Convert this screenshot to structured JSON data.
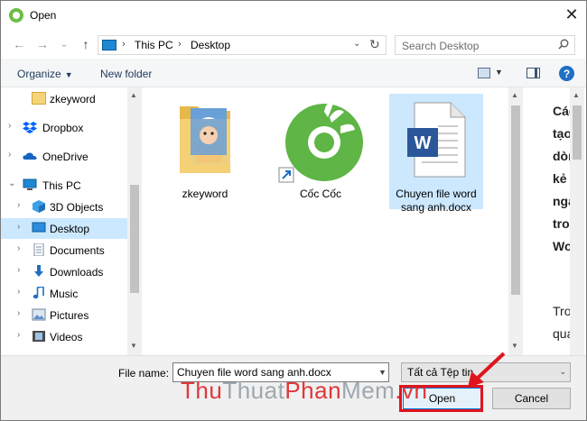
{
  "window": {
    "title": "Open",
    "close_label": "✕",
    "app_icon": "coccoc-icon"
  },
  "nav": {
    "back": "←",
    "forward": "→",
    "recent": "⌄",
    "up": "↑",
    "breadcrumb": [
      "This PC",
      "Desktop"
    ],
    "search_placeholder": "Search Desktop"
  },
  "toolbar": {
    "organize": "Organize",
    "new_folder": "New folder",
    "help": "?"
  },
  "sidebar": {
    "items": [
      {
        "label": "zkeyword",
        "icon": "folder-icon",
        "expandable": false,
        "selected": false
      },
      {
        "label": "Dropbox",
        "icon": "dropbox-icon",
        "expandable": true,
        "selected": false
      },
      {
        "label": "OneDrive",
        "icon": "onedrive-icon",
        "expandable": true,
        "selected": false
      },
      {
        "label": "This PC",
        "icon": "computer-icon",
        "expandable": true,
        "expanded": true,
        "selected": false
      },
      {
        "label": "3D Objects",
        "icon": "cube-icon",
        "expandable": true,
        "selected": false
      },
      {
        "label": "Desktop",
        "icon": "desktop-icon",
        "expandable": true,
        "selected": true
      },
      {
        "label": "Documents",
        "icon": "documents-icon",
        "expandable": true,
        "selected": false
      },
      {
        "label": "Downloads",
        "icon": "downloads-icon",
        "expandable": true,
        "selected": false
      },
      {
        "label": "Music",
        "icon": "music-icon",
        "expandable": true,
        "selected": false
      },
      {
        "label": "Pictures",
        "icon": "pictures-icon",
        "expandable": true,
        "selected": false
      },
      {
        "label": "Videos",
        "icon": "videos-icon",
        "expandable": true,
        "selected": false
      }
    ]
  },
  "files": [
    {
      "name": "zkeyword",
      "icon": "folder-thumbnail-icon",
      "selected": false
    },
    {
      "name": "Cốc Cốc",
      "icon": "coccoc-shortcut-icon",
      "selected": false
    },
    {
      "name": "Chuyen file word sang anh.docx",
      "icon": "word-document-icon",
      "selected": true
    }
  ],
  "preview": {
    "lines": [
      "Các",
      "tạo",
      "dòn",
      "kẻ",
      "nga",
      "tro",
      "Wo",
      "Tro",
      "qua"
    ]
  },
  "bottom": {
    "file_name_label": "File name:",
    "file_name_value": "Chuyen file word sang anh.docx",
    "file_type": "Tất cả Tệp tin",
    "open_label": "Open",
    "cancel_label": "Cancel"
  },
  "watermark": {
    "parts": [
      "Thu",
      "Thuat",
      "Phan",
      "Mem",
      ".vn"
    ]
  },
  "colors": {
    "accent": "#0078d7",
    "selection": "#cce8ff",
    "annotation_red": "#e0141c",
    "watermark_red": "#e0383b",
    "watermark_gray": "#9ea8b0"
  }
}
